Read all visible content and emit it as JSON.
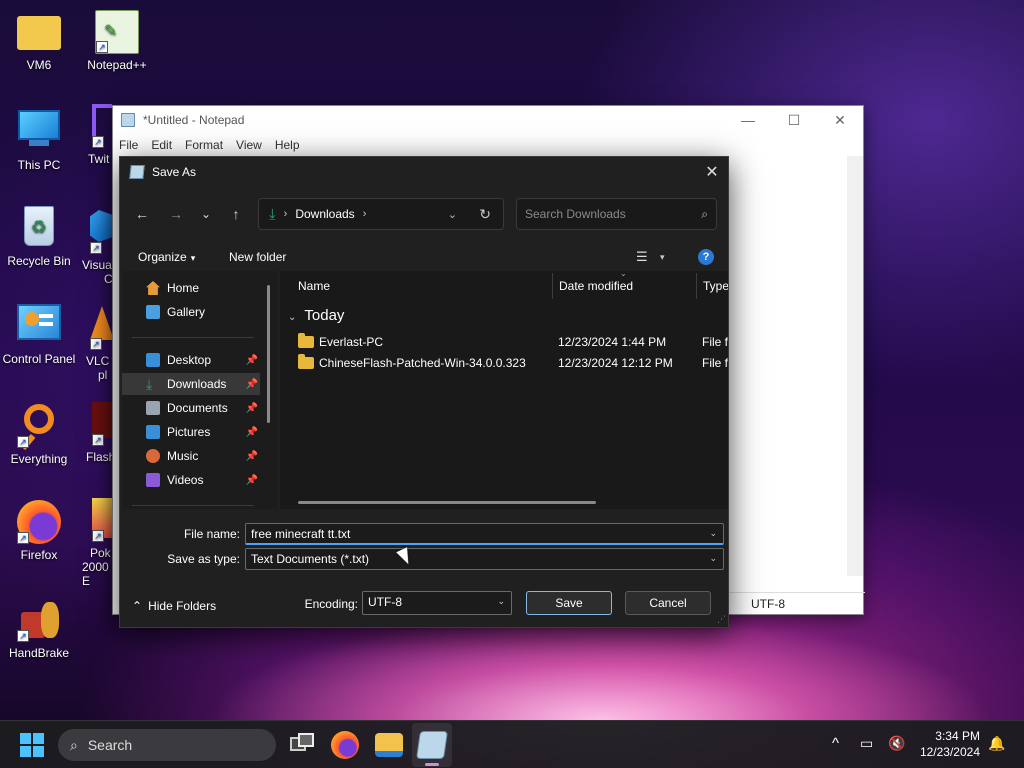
{
  "desktop": {
    "icons": [
      {
        "label": "VM6",
        "icon": "folder-icon"
      },
      {
        "label": "Notepad++",
        "icon": "notepadpp-icon"
      },
      {
        "label": "This PC",
        "icon": "monitor-icon"
      },
      {
        "label": "Twit",
        "icon": "twitch-icon"
      },
      {
        "label": "Recycle Bin",
        "icon": "recycle-bin-icon"
      },
      {
        "label": "Visua",
        "label2": "C",
        "icon": "vscode-icon"
      },
      {
        "label": "Control Panel",
        "icon": "control-panel-icon"
      },
      {
        "label": "VLC",
        "label2": "pl",
        "icon": "vlc-icon"
      },
      {
        "label": "Everything",
        "icon": "everything-icon"
      },
      {
        "label": "Flash",
        "icon": "flash-icon"
      },
      {
        "label": "Firefox",
        "icon": "firefox-icon"
      },
      {
        "label": "Pok",
        "label2": "2000 E",
        "icon": "pokemon-icon"
      },
      {
        "label": "HandBrake",
        "icon": "handbrake-icon"
      }
    ]
  },
  "notepad": {
    "title": "*Untitled - Notepad",
    "menu": [
      "File",
      "Edit",
      "Format",
      "View",
      "Help"
    ],
    "status_encoding": "UTF-8",
    "controls": {
      "minimize": "—",
      "maximize": "☐",
      "close": "✕"
    }
  },
  "dialog": {
    "title": "Save As",
    "close": "✕",
    "nav": {
      "back": "←",
      "forward": "→",
      "recent": "⌄",
      "up": "↑"
    },
    "address": {
      "chevron": "›",
      "location": "Downloads",
      "chevron2": "›",
      "dropdown": "⌄",
      "refresh": "↻"
    },
    "search": {
      "placeholder": "Search Downloads",
      "value": ""
    },
    "toolbar": {
      "organize": "Organize",
      "organize_caret": "▾",
      "new_folder": "New folder",
      "view_caret": "▾",
      "help": "?"
    },
    "sidebar": [
      {
        "label": "Home",
        "icon": "home-icon",
        "color": "#e59a3c"
      },
      {
        "label": "Gallery",
        "icon": "gallery-icon",
        "color": "#4a9fe0"
      },
      {
        "label": "Desktop",
        "icon": "desktop-icon",
        "color": "#3a8fd9",
        "pinned": true
      },
      {
        "label": "Downloads",
        "icon": "download-icon",
        "color": "#2ba36d",
        "pinned": true,
        "selected": true
      },
      {
        "label": "Documents",
        "icon": "documents-icon",
        "color": "#9aa4b0",
        "pinned": true
      },
      {
        "label": "Pictures",
        "icon": "pictures-icon",
        "color": "#3a8fd9",
        "pinned": true
      },
      {
        "label": "Music",
        "icon": "music-icon",
        "color": "#d9693a",
        "pinned": true
      },
      {
        "label": "Videos",
        "icon": "videos-icon",
        "color": "#8a5ad9",
        "pinned": true
      }
    ],
    "columns": {
      "name": "Name",
      "date": "Date modified",
      "type": "Type"
    },
    "group": {
      "caret": "⌄",
      "label": "Today"
    },
    "files": [
      {
        "name": "Everlast-PC",
        "date": "12/23/2024 1:44 PM",
        "type": "File fo"
      },
      {
        "name": "ChineseFlash-Patched-Win-34.0.0.323",
        "date": "12/23/2024 12:12 PM",
        "type": "File fo"
      }
    ],
    "form": {
      "file_name_label": "File name:",
      "file_name_value": "free minecraft tt.txt",
      "save_type_label": "Save as type:",
      "save_type_value": "Text Documents (*.txt)",
      "encoding_label": "Encoding:",
      "encoding_value": "UTF-8",
      "save": "Save",
      "cancel": "Cancel",
      "hide_folders": "Hide Folders",
      "hide_caret": "⌃",
      "dropdown": "⌄"
    }
  },
  "taskbar": {
    "search": "Search",
    "time": "3:34 PM",
    "date": "12/23/2024",
    "tray_chevron": "^"
  },
  "colors": {
    "accent": "#4cc2ff",
    "folder": "#e8b83a",
    "help": "#2b79d6"
  }
}
